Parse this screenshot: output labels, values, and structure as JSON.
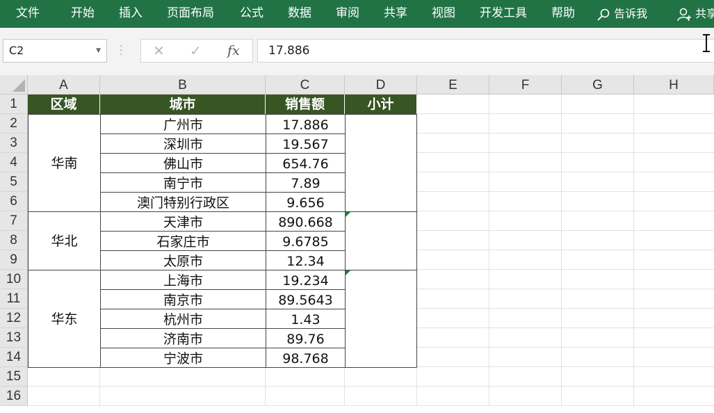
{
  "ribbon": {
    "tabs": [
      "文件",
      "开始",
      "插入",
      "页面布局",
      "公式",
      "数据",
      "审阅",
      "共享",
      "视图",
      "开发工具",
      "帮助"
    ],
    "tell_me": "告诉我",
    "share": "共享"
  },
  "formula_bar": {
    "name_box": "C2",
    "value": "17.886",
    "cancel_icon": "✕",
    "enter_icon": "✓",
    "fx_label": "fx"
  },
  "sheet": {
    "columns": [
      "A",
      "B",
      "C",
      "D",
      "E",
      "F",
      "G",
      "H"
    ],
    "rows": [
      "1",
      "2",
      "3",
      "4",
      "5",
      "6",
      "7",
      "8",
      "9",
      "10",
      "11",
      "12",
      "13",
      "14",
      "15",
      "16"
    ],
    "header": [
      "区域",
      "城市",
      "销售额",
      "小计"
    ],
    "regions": [
      "华南",
      "华北",
      "华东"
    ],
    "cities": [
      "广州市",
      "深圳市",
      "佛山市",
      "南宁市",
      "澳门特别行政区",
      "天津市",
      "石家庄市",
      "太原市",
      "上海市",
      "南京市",
      "杭州市",
      "济南市",
      "宁波市"
    ],
    "sales": [
      "17.886",
      "19.567",
      "654.76",
      "7.89",
      "9.656",
      "890.668",
      "9.6785",
      "12.34",
      "19.234",
      "89.5643",
      "1.43",
      "89.76",
      "98.768"
    ]
  },
  "colors": {
    "ribbon": "#217346",
    "table_header": "#375623",
    "error_indicator": "#1e7b34"
  }
}
